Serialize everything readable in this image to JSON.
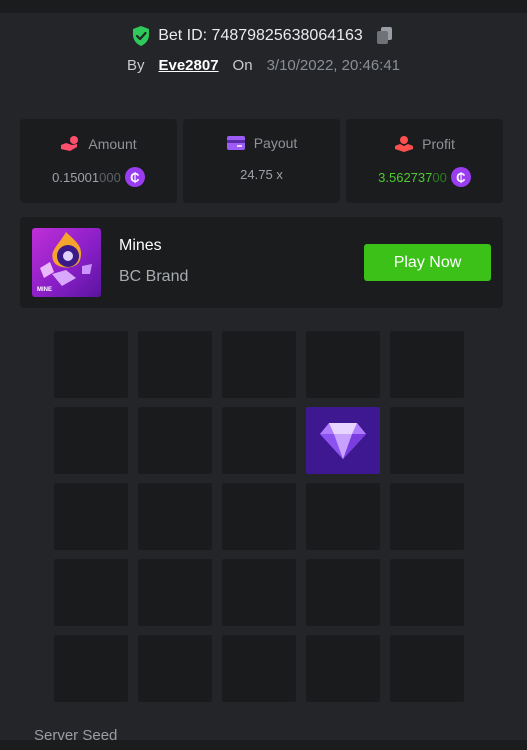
{
  "bet": {
    "id_label": "Bet ID: 74879825638064163",
    "by_label": "By",
    "username": "Eve2807",
    "on_label": "On",
    "date": "3/10/2022, 20:46:41"
  },
  "stats": {
    "amount": {
      "label": "Amount",
      "value_main": "0.15001",
      "value_dim": "000",
      "icon": "hand-coins-icon"
    },
    "payout": {
      "label": "Payout",
      "value": "24.75 x",
      "icon": "card-icon"
    },
    "profit": {
      "label": "Profit",
      "value_main": "3.562737",
      "value_dim": "00",
      "icon": "hand-profit-icon"
    },
    "coin_symbol": "₵"
  },
  "game": {
    "title": "Mines",
    "provider": "BC Brand",
    "thumb_text": "MINE",
    "play_label": "Play Now"
  },
  "board": {
    "rows": 5,
    "cols": 5,
    "revealed_gem": {
      "row": 2,
      "col": 4
    }
  },
  "seed_label": "Server Seed",
  "colors": {
    "accent_green": "#3bc117",
    "profit_green": "#4ecb2c",
    "coin_purple": "#9a3cf0",
    "gem_tile": "#3e1891"
  }
}
